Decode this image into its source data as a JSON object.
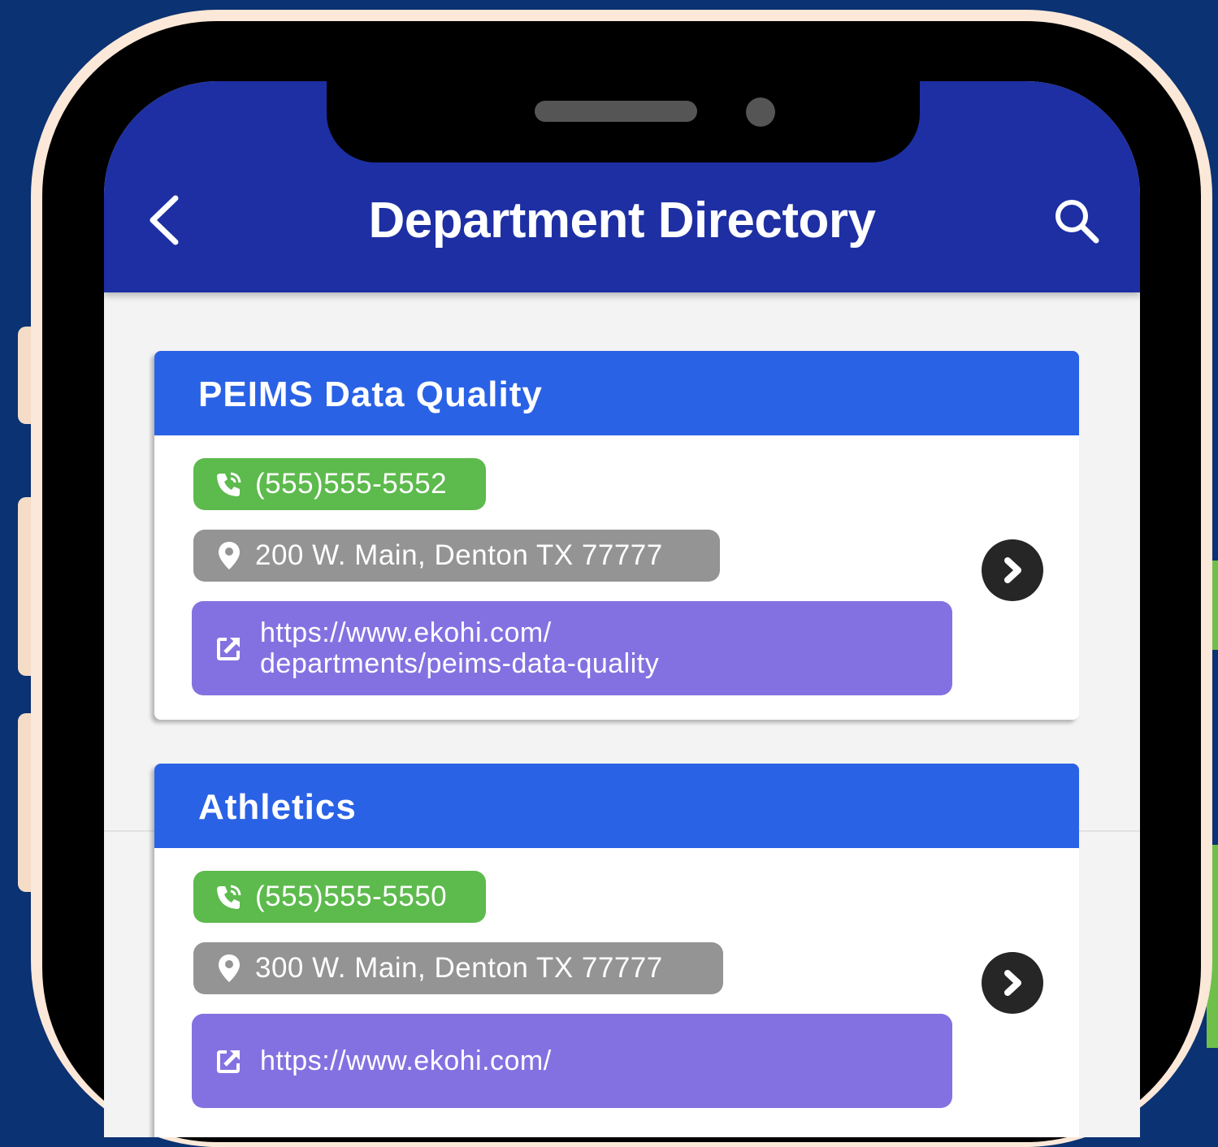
{
  "header": {
    "title": "Department Directory"
  },
  "departments": [
    {
      "name": "PEIMS Data Quality",
      "phone": "(555)555-5552",
      "address": "200 W. Main, Denton TX 77777",
      "url_line1": "https://www.ekohi.com/",
      "url_line2": "departments/peims-data-quality"
    },
    {
      "name": "Athletics",
      "phone": "(555)555-5550",
      "address": "300 W. Main, Denton TX 77777",
      "url_line1": "https://www.ekohi.com/",
      "url_line2": ""
    }
  ],
  "icons": {
    "back": "chevron-left-icon",
    "search": "search-icon",
    "phone": "phone-call-icon",
    "address": "map-pin-icon",
    "url": "external-link-icon",
    "detail": "chevron-right-circle-icon"
  },
  "colors": {
    "app_bar": "#1d2fa3",
    "card_header": "#2a62e6",
    "phone_pill": "#5dba4d",
    "address_pill": "#949494",
    "url_pill": "#8471e1"
  }
}
